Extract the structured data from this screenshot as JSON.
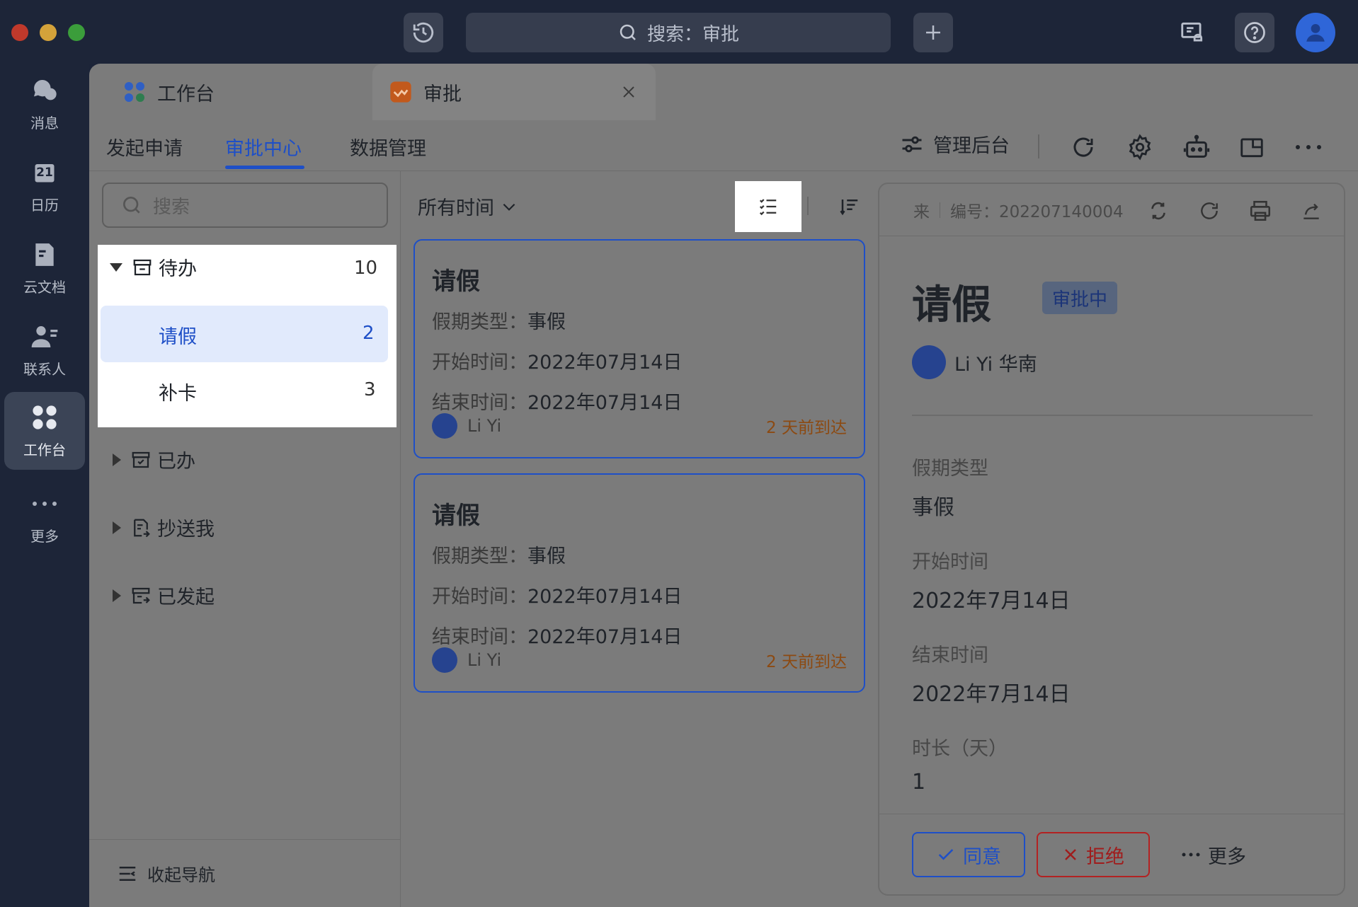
{
  "window": {
    "search_text": "搜索：审批"
  },
  "rail": {
    "items": [
      {
        "label": "消息"
      },
      {
        "label": "日历",
        "day": "21"
      },
      {
        "label": "云文档"
      },
      {
        "label": "联系人"
      },
      {
        "label": "工作台"
      },
      {
        "label": "更多"
      }
    ]
  },
  "tabs": [
    {
      "label": "工作台"
    },
    {
      "label": "审批"
    }
  ],
  "subnav": {
    "items": [
      "发起申请",
      "审批中心",
      "数据管理"
    ],
    "active": "审批中心",
    "admin_label": "管理后台"
  },
  "left": {
    "search_placeholder": "搜索",
    "groups": [
      {
        "label": "待办",
        "count": "10",
        "expanded": true,
        "children": [
          {
            "label": "请假",
            "count": "2",
            "selected": true
          },
          {
            "label": "补卡",
            "count": "3",
            "selected": false
          }
        ]
      },
      {
        "label": "已办",
        "expanded": false
      },
      {
        "label": "抄送我",
        "expanded": false
      },
      {
        "label": "已发起",
        "expanded": false
      }
    ],
    "collapse_label": "收起导航"
  },
  "list": {
    "time_filter": "所有时间",
    "cards": [
      {
        "title": "请假",
        "type_label": "假期类型：",
        "type_value": "事假",
        "start_label": "开始时间：",
        "start_value": "2022年07月14日",
        "end_label": "结束时间：",
        "end_value": "2022年07月14日",
        "user": "Li Yi",
        "arrived": "2 天前到达"
      },
      {
        "title": "请假",
        "type_label": "假期类型：",
        "type_value": "事假",
        "start_label": "开始时间：",
        "start_value": "2022年07月14日",
        "end_label": "结束时间：",
        "end_value": "2022年07月14日",
        "user": "Li Yi",
        "arrived": "2 天前到达"
      }
    ]
  },
  "detail": {
    "source": "来",
    "number": "编号：202207140004",
    "title": "请假",
    "status": "审批中",
    "applicant": "Li Yi  华南",
    "fields": [
      {
        "label": "假期类型",
        "value": "事假"
      },
      {
        "label": "开始时间",
        "value": "2022年7月14日"
      },
      {
        "label": "结束时间",
        "value": "2022年7月14日"
      },
      {
        "label": "时长（天）",
        "value": "1"
      }
    ],
    "approve_label": "同意",
    "reject_label": "拒绝",
    "more_label": "更多"
  },
  "colors": {
    "accent": "#1e4fc7",
    "reject": "#b32222",
    "arrived": "#8c4a12"
  }
}
